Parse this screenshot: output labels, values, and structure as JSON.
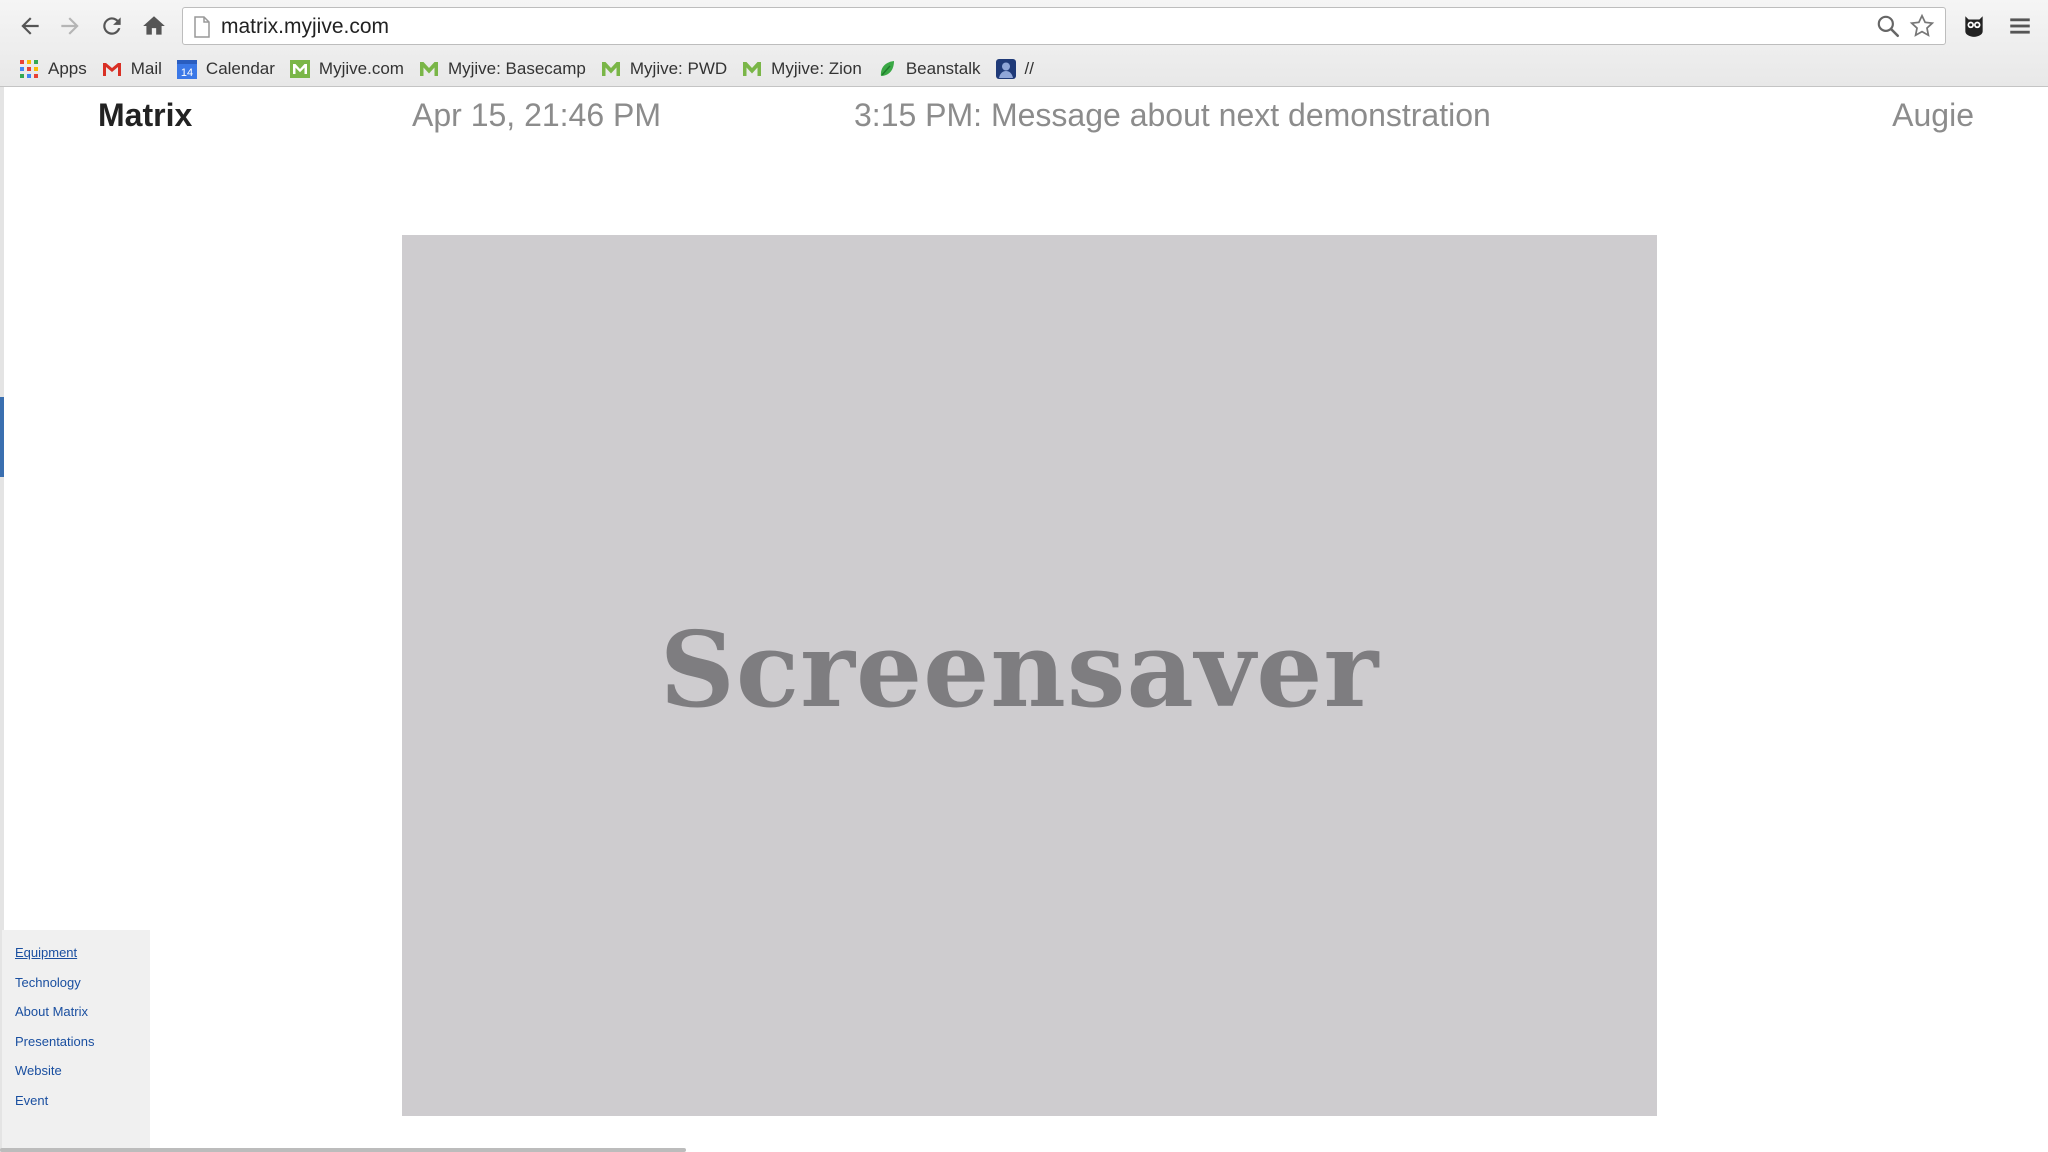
{
  "browser": {
    "url": "matrix.myjive.com",
    "bookmarks": [
      {
        "label": "Apps",
        "icon": "apps-grid-icon"
      },
      {
        "label": "Mail",
        "icon": "gmail-icon"
      },
      {
        "label": "Calendar",
        "icon": "calendar-icon",
        "badge": "14"
      },
      {
        "label": "Myjive.com",
        "icon": "myjive-icon"
      },
      {
        "label": "Myjive: Basecamp",
        "icon": "myjive-icon"
      },
      {
        "label": "Myjive: PWD",
        "icon": "myjive-icon"
      },
      {
        "label": "Myjive: Zion",
        "icon": "myjive-icon"
      },
      {
        "label": "Beanstalk",
        "icon": "beanstalk-icon"
      },
      {
        "label": "//",
        "icon": "profile-icon"
      }
    ]
  },
  "header": {
    "brand": "Matrix",
    "datetime": "Apr 15, 21:46 PM",
    "message": "3:15 PM: Message about next demonstration",
    "user": "Augie"
  },
  "main": {
    "screensaver_label": "Screensaver"
  },
  "sidebar": {
    "items": [
      {
        "label": "Equipment"
      },
      {
        "label": "Technology"
      },
      {
        "label": "About Matrix"
      },
      {
        "label": "Presentations"
      },
      {
        "label": "Website"
      },
      {
        "label": "Event"
      }
    ]
  },
  "colors": {
    "screensaver_bg": "#cecccf",
    "screensaver_text": "#7e7d80",
    "link": "#1a4fa0",
    "header_text": "#8c8c8c",
    "myjive_green": "#7ab648"
  }
}
